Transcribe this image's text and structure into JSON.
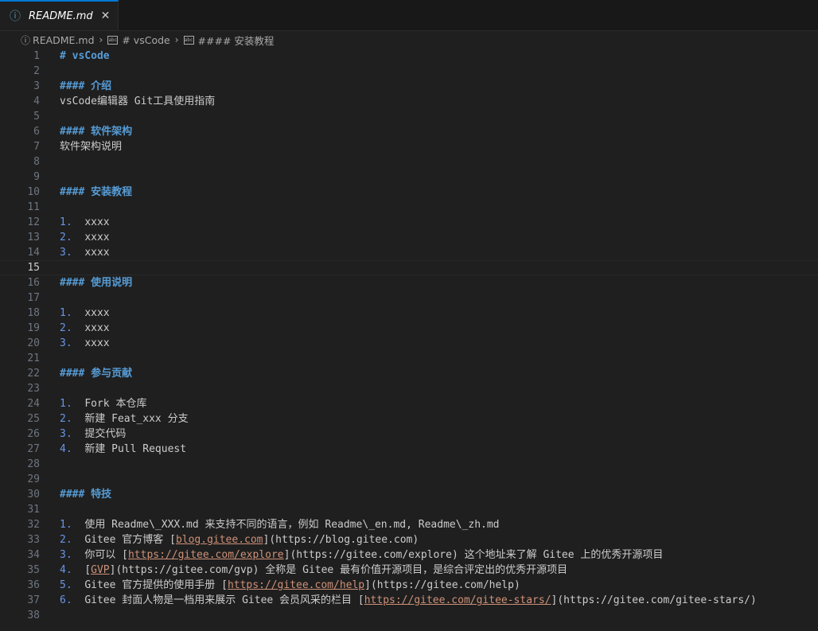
{
  "tab": {
    "icon": "info-icon",
    "label": "README.md",
    "close": "✕"
  },
  "breadcrumb": {
    "file": "README.md",
    "h1": "# vsCode",
    "h4": "#### 安装教程"
  },
  "lines": [
    [
      {
        "t": "h",
        "v": "# vsCode"
      }
    ],
    [],
    [
      {
        "t": "h",
        "v": "#### 介绍"
      }
    ],
    [
      {
        "t": "txt",
        "v": "vsCode编辑器 Git工具使用指南"
      }
    ],
    [],
    [
      {
        "t": "h",
        "v": "#### 软件架构"
      }
    ],
    [
      {
        "t": "txt",
        "v": "软件架构说明"
      }
    ],
    [],
    [],
    [
      {
        "t": "h",
        "v": "#### 安装教程"
      }
    ],
    [],
    [
      {
        "t": "num",
        "v": "1.  "
      },
      {
        "t": "txt",
        "v": "xxxx"
      }
    ],
    [
      {
        "t": "num",
        "v": "2.  "
      },
      {
        "t": "txt",
        "v": "xxxx"
      }
    ],
    [
      {
        "t": "num",
        "v": "3.  "
      },
      {
        "t": "txt",
        "v": "xxxx"
      }
    ],
    [],
    [
      {
        "t": "h",
        "v": "#### 使用说明"
      }
    ],
    [],
    [
      {
        "t": "num",
        "v": "1.  "
      },
      {
        "t": "txt",
        "v": "xxxx"
      }
    ],
    [
      {
        "t": "num",
        "v": "2.  "
      },
      {
        "t": "txt",
        "v": "xxxx"
      }
    ],
    [
      {
        "t": "num",
        "v": "3.  "
      },
      {
        "t": "txt",
        "v": "xxxx"
      }
    ],
    [],
    [
      {
        "t": "h",
        "v": "#### 参与贡献"
      }
    ],
    [],
    [
      {
        "t": "num",
        "v": "1.  "
      },
      {
        "t": "txt",
        "v": "Fork 本仓库"
      }
    ],
    [
      {
        "t": "num",
        "v": "2.  "
      },
      {
        "t": "txt",
        "v": "新建 Feat_xxx 分支"
      }
    ],
    [
      {
        "t": "num",
        "v": "3.  "
      },
      {
        "t": "txt",
        "v": "提交代码"
      }
    ],
    [
      {
        "t": "num",
        "v": "4.  "
      },
      {
        "t": "txt",
        "v": "新建 Pull Request"
      }
    ],
    [],
    [],
    [
      {
        "t": "h",
        "v": "#### 特技"
      }
    ],
    [],
    [
      {
        "t": "num",
        "v": "1.  "
      },
      {
        "t": "txt",
        "v": "使用 Readme\\_XXX.md 来支持不同的语言，例如 Readme\\_en.md, Readme\\_zh.md"
      }
    ],
    [
      {
        "t": "num",
        "v": "2.  "
      },
      {
        "t": "txt",
        "v": "Gitee 官方博客 ["
      },
      {
        "t": "link",
        "v": "blog.gitee.com"
      },
      {
        "t": "txt",
        "v": "](https://blog.gitee.com)"
      }
    ],
    [
      {
        "t": "num",
        "v": "3.  "
      },
      {
        "t": "txt",
        "v": "你可以 ["
      },
      {
        "t": "link",
        "v": "https://gitee.com/explore"
      },
      {
        "t": "txt",
        "v": "](https://gitee.com/explore) 这个地址来了解 Gitee 上的优秀开源项目"
      }
    ],
    [
      {
        "t": "num",
        "v": "4.  "
      },
      {
        "t": "txt",
        "v": "["
      },
      {
        "t": "link",
        "v": "GVP"
      },
      {
        "t": "txt",
        "v": "](https://gitee.com/gvp) 全称是 Gitee 最有价值开源项目，是综合评定出的优秀开源项目"
      }
    ],
    [
      {
        "t": "num",
        "v": "5.  "
      },
      {
        "t": "txt",
        "v": "Gitee 官方提供的使用手册 ["
      },
      {
        "t": "link",
        "v": "https://gitee.com/help"
      },
      {
        "t": "txt",
        "v": "](https://gitee.com/help)"
      }
    ],
    [
      {
        "t": "num",
        "v": "6.  "
      },
      {
        "t": "txt",
        "v": "Gitee 封面人物是一档用来展示 Gitee 会员风采的栏目 ["
      },
      {
        "t": "link",
        "v": "https://gitee.com/gitee-stars/"
      },
      {
        "t": "txt",
        "v": "](https://gitee.com/gitee-stars/)"
      }
    ],
    []
  ],
  "current_line": 15,
  "colors": {
    "heading": "#569cd6",
    "link": "#ce9178",
    "list_marker": "#6796e6",
    "accent": "#0078d4"
  }
}
